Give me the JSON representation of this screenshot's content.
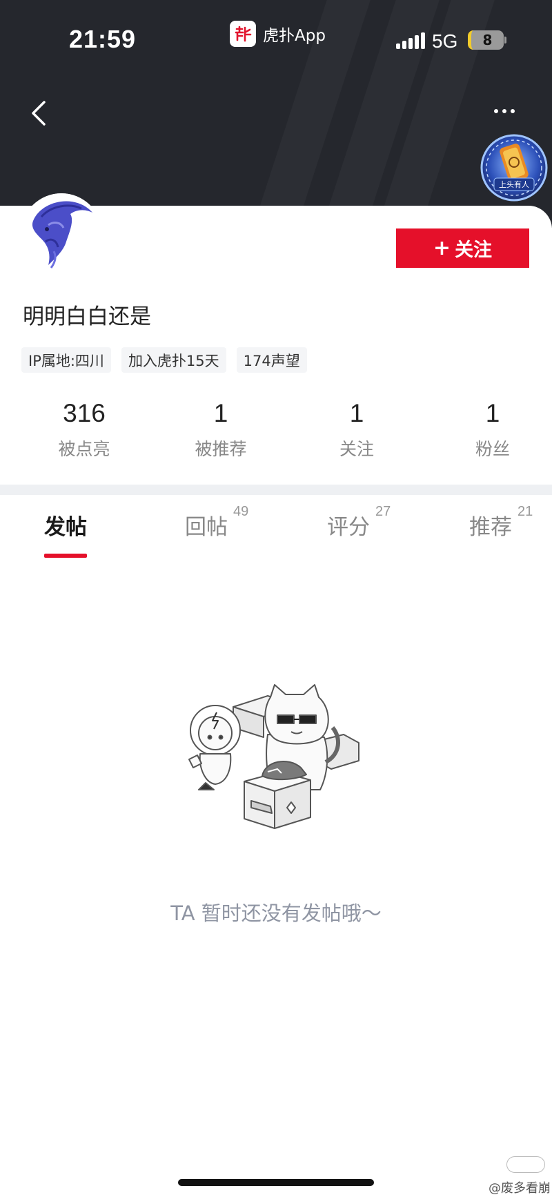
{
  "status_bar": {
    "time": "21:59",
    "app_name": "虎扑App",
    "app_logo_glyph": "虎扑",
    "network": "5G",
    "battery": "8"
  },
  "header": {
    "back_icon": "chevron-left-icon",
    "more_icon": "more-horizontal-icon",
    "medal_badge_text": "上头有人"
  },
  "profile": {
    "username": "明明白白还是",
    "follow_label": "关注",
    "follow_icon": "plus-icon",
    "tags": [
      {
        "text": "IP属地:四川"
      },
      {
        "text": "加入虎扑15天"
      },
      {
        "text": "174声望"
      }
    ]
  },
  "stats": [
    {
      "value": "316",
      "label": "被点亮"
    },
    {
      "value": "1",
      "label": "被推荐"
    },
    {
      "value": "1",
      "label": "关注"
    },
    {
      "value": "1",
      "label": "粉丝"
    }
  ],
  "tabs": [
    {
      "label": "发帖",
      "count": "",
      "active": true
    },
    {
      "label": "回帖",
      "count": "49",
      "active": false
    },
    {
      "label": "评分",
      "count": "27",
      "active": false
    },
    {
      "label": "推荐",
      "count": "21",
      "active": false
    }
  ],
  "empty_state": {
    "message": "TA 暂时还没有发帖哦～"
  },
  "watermark": "@废多看崩",
  "colors": {
    "header_bg": "#25272d",
    "accent_red": "#e5102a",
    "muted_text": "#8f95a3"
  }
}
